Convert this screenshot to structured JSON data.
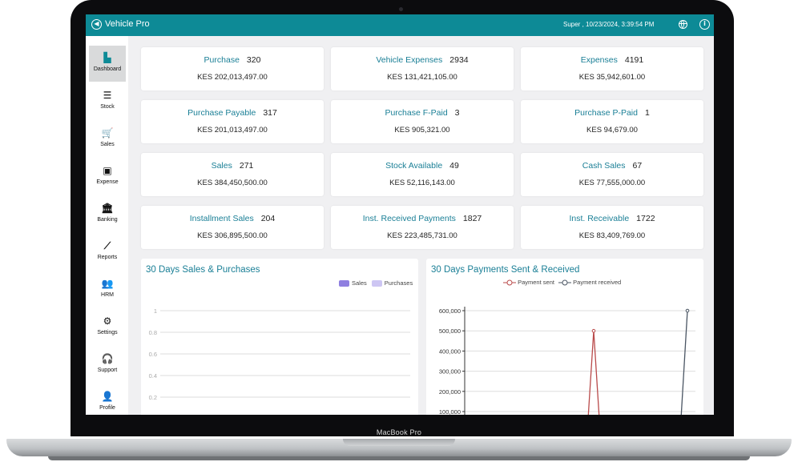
{
  "app": {
    "title": "Vehicle Pro",
    "status": "Super ,  10/23/2024, 3:39:54 PM",
    "icons": {
      "back": "back-circle-icon",
      "globe": "globe-icon",
      "info": "info-icon"
    }
  },
  "device": {
    "label": "MacBook Pro"
  },
  "sidebar": {
    "items": [
      {
        "label": "Dashboard",
        "icon": "dashboard-icon",
        "glyph": "▙",
        "active": true
      },
      {
        "label": "Stock",
        "icon": "list-icon",
        "glyph": "☰"
      },
      {
        "label": "Sales",
        "icon": "cart-icon",
        "glyph": "🛒"
      },
      {
        "label": "Expense",
        "icon": "money-icon",
        "glyph": "▣"
      },
      {
        "label": "Banking",
        "icon": "bank-icon",
        "glyph": "🏛"
      },
      {
        "label": "Reports",
        "icon": "line-chart-icon",
        "glyph": "⟋"
      },
      {
        "label": "HRM",
        "icon": "users-icon",
        "glyph": "👥"
      },
      {
        "label": "Settings",
        "icon": "gears-icon",
        "glyph": "⚙"
      },
      {
        "label": "Support",
        "icon": "headset-icon",
        "glyph": "🎧"
      },
      {
        "label": "Profile",
        "icon": "user-icon",
        "glyph": "👤"
      }
    ]
  },
  "cards": [
    {
      "name": "Purchase",
      "count": "320",
      "amount": "KES 202,013,497.00"
    },
    {
      "name": "Vehicle Expenses",
      "count": "2934",
      "amount": "KES 131,421,105.00"
    },
    {
      "name": "Expenses",
      "count": "4191",
      "amount": "KES 35,942,601.00"
    },
    {
      "name": "Purchase Payable",
      "count": "317",
      "amount": "KES 201,013,497.00"
    },
    {
      "name": "Purchase F-Paid",
      "count": "3",
      "amount": "KES 905,321.00"
    },
    {
      "name": "Purchase P-Paid",
      "count": "1",
      "amount": "KES 94,679.00"
    },
    {
      "name": "Sales",
      "count": "271",
      "amount": "KES 384,450,500.00"
    },
    {
      "name": "Stock Available",
      "count": "49",
      "amount": "KES 52,116,143.00"
    },
    {
      "name": "Cash Sales",
      "count": "67",
      "amount": "KES 77,555,000.00"
    },
    {
      "name": "Installment Sales",
      "count": "204",
      "amount": "KES 306,895,500.00"
    },
    {
      "name": "Inst. Received Payments",
      "count": "1827",
      "amount": "KES 223,485,731.00"
    },
    {
      "name": "Inst. Receivable",
      "count": "1722",
      "amount": "KES 83,409,769.00"
    }
  ],
  "chart_data": [
    {
      "type": "bar",
      "title": "30 Days Sales & Purchases",
      "series": [
        {
          "name": "Sales",
          "color": "#8f7fe0",
          "values": []
        },
        {
          "name": "Purchases",
          "color": "#cdc6f3",
          "values": []
        }
      ],
      "y_ticks": [
        "1",
        "0.8",
        "0.6",
        "0.4",
        "0.2"
      ],
      "ylim": [
        0,
        1
      ],
      "grid": true,
      "legend": "top-right"
    },
    {
      "type": "line",
      "title": "30 Days Payments Sent & Received",
      "series": [
        {
          "name": "Payment sent",
          "color": "#b94a4a",
          "values": [
            0,
            500000,
            0
          ]
        },
        {
          "name": "Payment received",
          "color": "#4a5563",
          "values": [
            0,
            600000
          ]
        }
      ],
      "y_ticks": [
        "600,000",
        "500,000",
        "400,000",
        "300,000",
        "200,000",
        "100,000"
      ],
      "ylim": [
        0,
        600000
      ],
      "grid": true,
      "legend": "top-center"
    }
  ]
}
